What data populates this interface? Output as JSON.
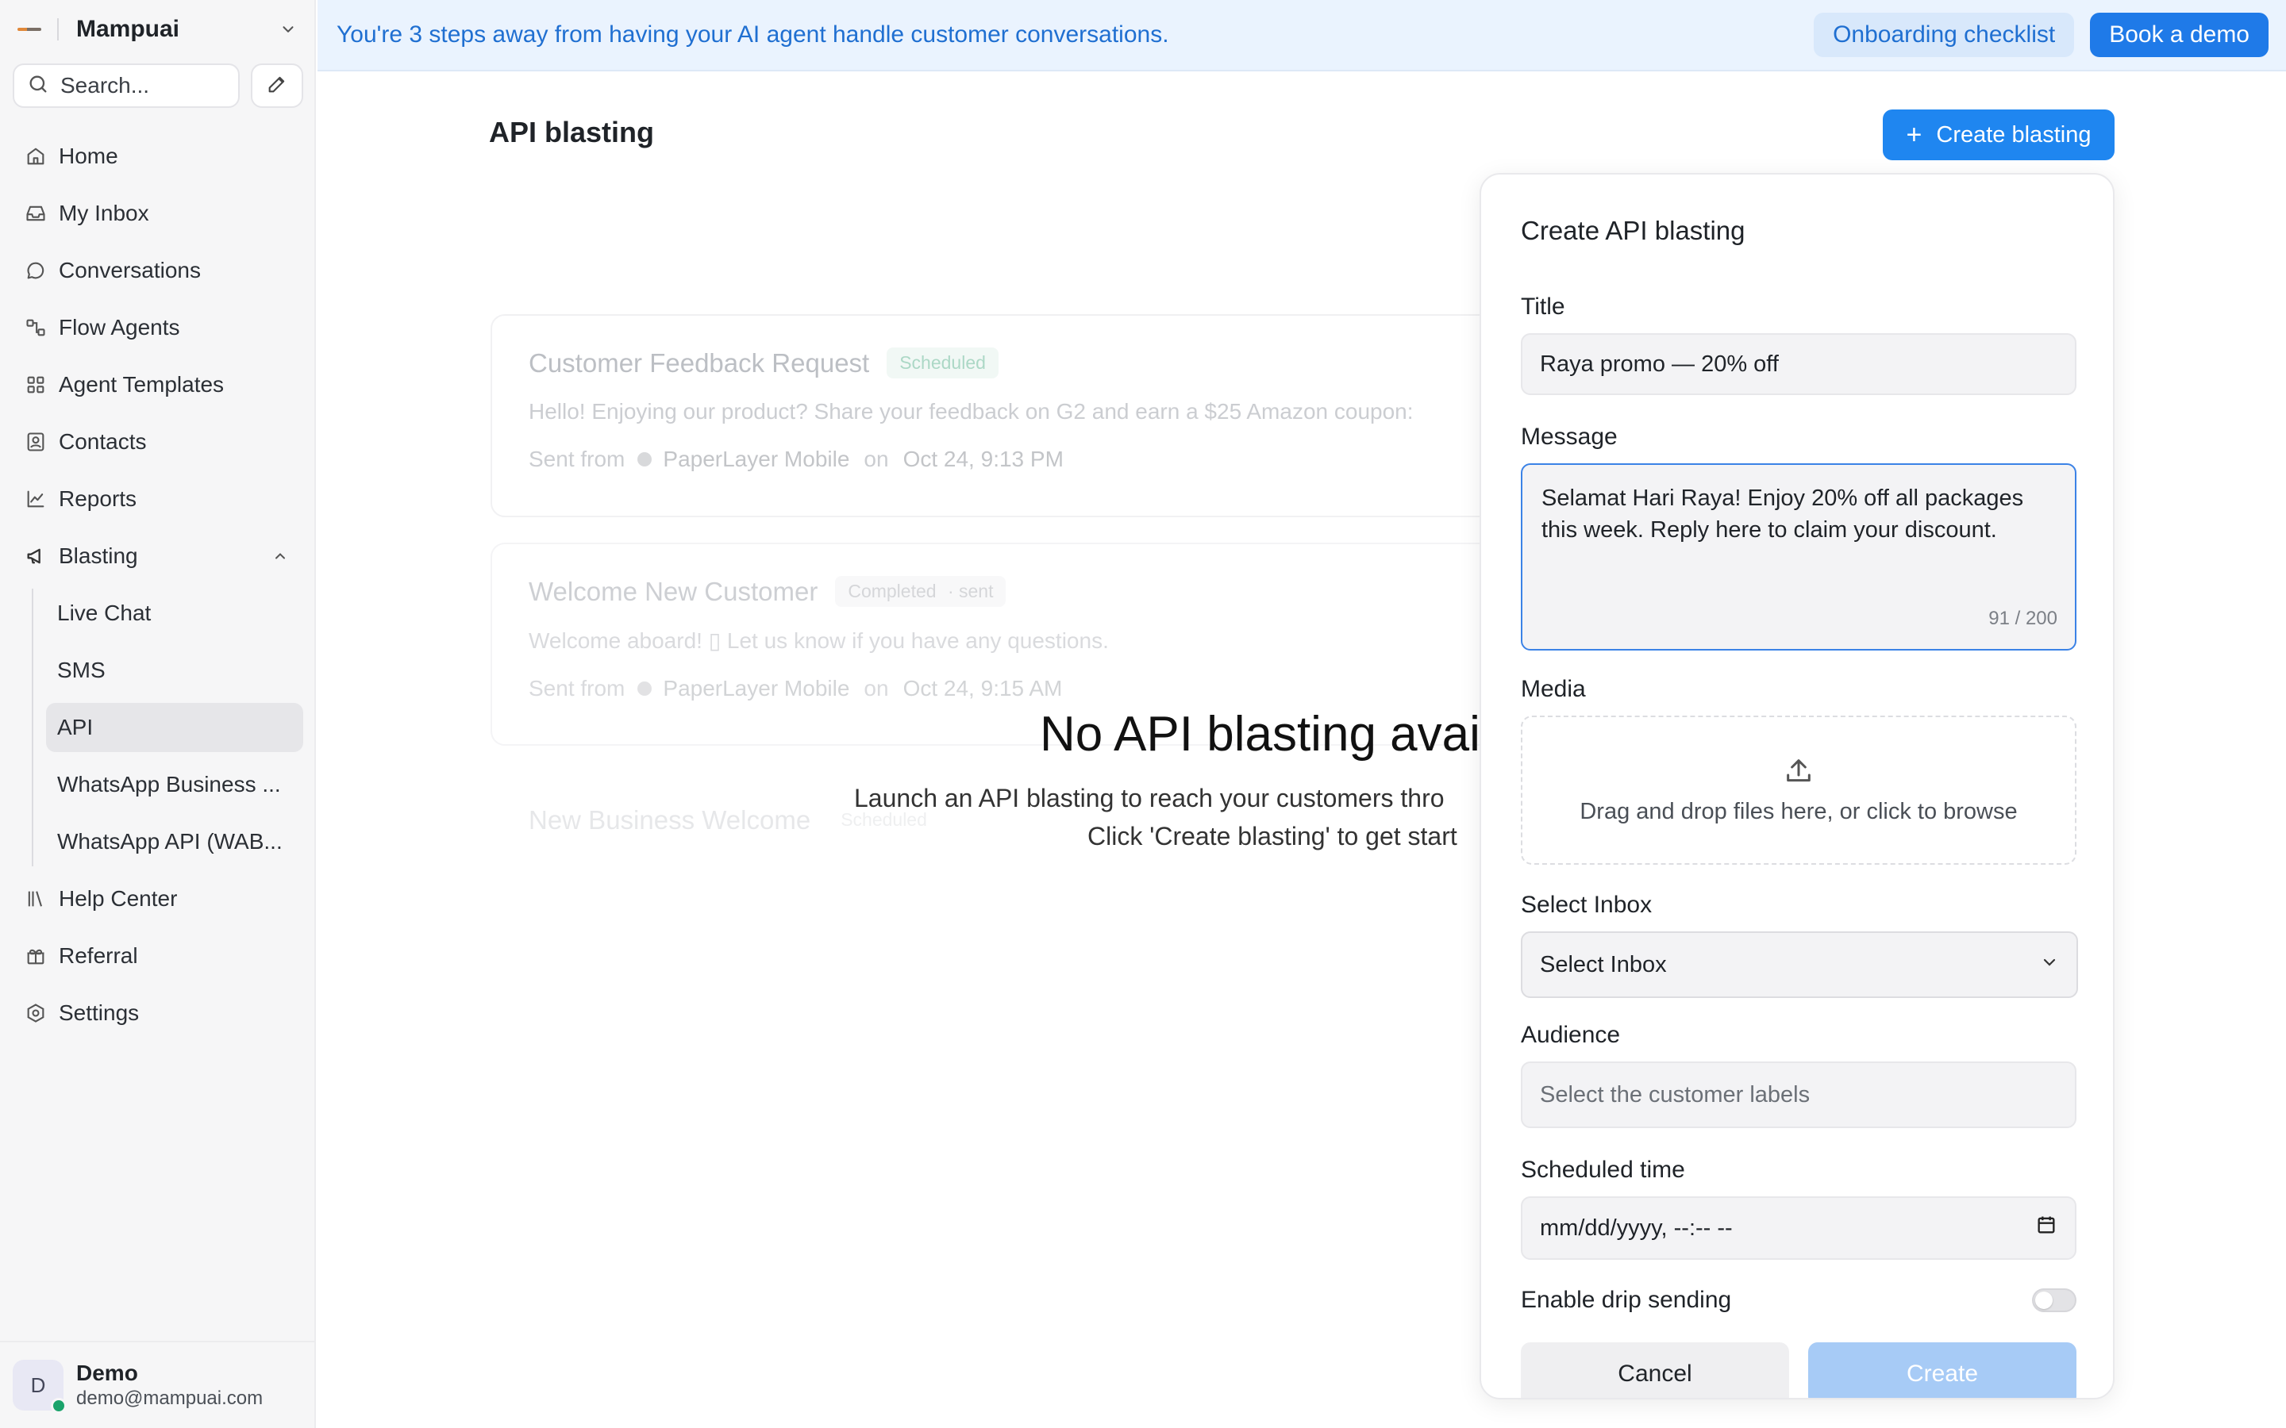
{
  "workspace": {
    "name": "Mampuai"
  },
  "search": {
    "placeholder": "Search..."
  },
  "nav": {
    "items": [
      {
        "label": "Home",
        "icon": "home-icon"
      },
      {
        "label": "My Inbox",
        "icon": "inbox-icon"
      },
      {
        "label": "Conversations",
        "icon": "chat-icon"
      },
      {
        "label": "Flow Agents",
        "icon": "flow-icon"
      },
      {
        "label": "Agent Templates",
        "icon": "grid-icon"
      },
      {
        "label": "Contacts",
        "icon": "contacts-icon"
      },
      {
        "label": "Reports",
        "icon": "chart-icon"
      }
    ],
    "blasting": {
      "label": "Blasting",
      "icon": "megaphone-icon",
      "sub": [
        "Live Chat",
        "SMS",
        "API",
        "WhatsApp Business ...",
        "WhatsApp API (WAB..."
      ],
      "active": "API"
    },
    "bottom": [
      {
        "label": "Help Center",
        "icon": "library-icon"
      },
      {
        "label": "Referral",
        "icon": "gift-icon"
      },
      {
        "label": "Settings",
        "icon": "settings-icon"
      }
    ]
  },
  "user": {
    "initial": "D",
    "name": "Demo",
    "email": "demo@mampuai.com",
    "status_color": "#1aa36b"
  },
  "banner": {
    "text": "You're 3 steps away from having your AI agent handle customer conversations.",
    "checklist_label": "Onboarding checklist",
    "demo_label": "Book a demo"
  },
  "page": {
    "title": "API blasting",
    "create_label": "Create blasting",
    "empty_title": "No API blasting availa",
    "empty_sub_1": "Launch an API blasting to reach your customers thro",
    "empty_sub_2": "Click 'Create blasting' to get start"
  },
  "ghost_cards": [
    {
      "title": "Customer Feedback Request",
      "badge": "Scheduled",
      "message": "Hello! Enjoying our product? Share your feedback on G2 and earn a $25 Amazon coupon:",
      "sent_from": "Sent from",
      "inbox": "PaperLayer Mobile",
      "on": "on",
      "date": "Oct 24, 9:13 PM"
    },
    {
      "title": "Welcome New Customer",
      "badge": "Completed",
      "badge_extra": "· sent",
      "message": "Welcome aboard! ▯ Let us know if you have any questions.",
      "sent_from": "Sent from",
      "inbox": "PaperLayer Mobile",
      "on": "on",
      "date": "Oct 24, 9:15 AM"
    },
    {
      "title": "New Business Welcome",
      "badge": "Scheduled"
    }
  ],
  "form": {
    "title": "Create API blasting",
    "title_label": "Title",
    "title_value": "Raya promo — 20% off",
    "message_label": "Message",
    "message_value": "Selamat Hari Raya! Enjoy 20% off all packages this week. Reply here to claim your discount.",
    "message_counter": "91 / 200",
    "media_label": "Media",
    "media_hint": "Drag and drop files here, or click to browse",
    "inbox_label": "Select Inbox",
    "inbox_value": "Select Inbox",
    "audience_label": "Audience",
    "audience_placeholder": "Select the customer labels",
    "schedule_label": "Scheduled time",
    "schedule_placeholder": "mm/dd/yyyy, --:-- --",
    "drip_label": "Enable drip sending",
    "drip_enabled": false,
    "cancel_label": "Cancel",
    "submit_label": "Create"
  },
  "colors": {
    "accent": "#1f86f0",
    "banner_bg": "#eaf3fe",
    "banner_text": "#1f6fd1",
    "submit_disabled": "#a7cbf6"
  }
}
